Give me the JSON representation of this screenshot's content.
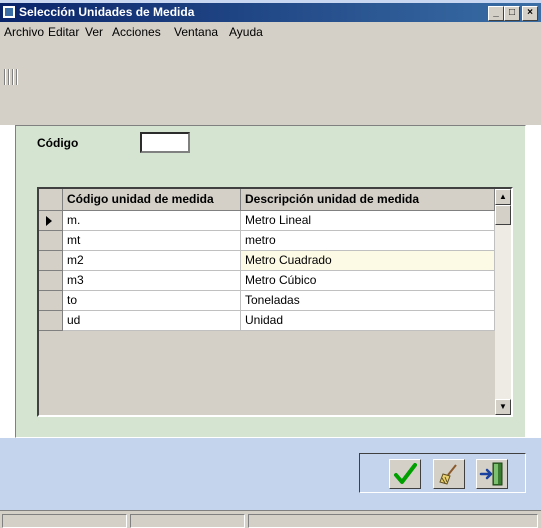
{
  "window": {
    "title": "Selección Unidades de Medida"
  },
  "titlebar_buttons": {
    "minimize": "_",
    "restore": "□",
    "close": "×"
  },
  "menu": [
    {
      "label": "Archivo"
    },
    {
      "label": "Editar"
    },
    {
      "label": "Ver"
    },
    {
      "label": "Acciones"
    },
    {
      "label": "Ventana"
    },
    {
      "label": "Ayuda"
    }
  ],
  "form": {
    "codigo_label": "Código",
    "codigo_value": ""
  },
  "grid": {
    "headers": [
      "Código unidad de medida",
      "Descripción unidad de medida"
    ],
    "rows": [
      {
        "code": "m.",
        "description": "Metro Lineal"
      },
      {
        "code": "mt",
        "description": "metro"
      },
      {
        "code": "m2",
        "description": "Metro Cuadrado"
      },
      {
        "code": "m3",
        "description": "Metro Cúbico"
      },
      {
        "code": "to",
        "description": "Toneladas"
      },
      {
        "code": "ud",
        "description": "Unidad"
      }
    ],
    "selected_row": 0,
    "current_cell": "Metro Cuadrado"
  },
  "scrollbar": {
    "up": "▲",
    "down": "▼"
  },
  "actions": [
    {
      "icon": "checkmark-icon"
    },
    {
      "icon": "broom-icon"
    },
    {
      "icon": "exit-door-icon"
    }
  ],
  "colors": {
    "titlebar": "#0a246a",
    "panel": "#d4e4d0",
    "bottom_area": "#c4d4ec",
    "checkmark": "#00a000"
  }
}
